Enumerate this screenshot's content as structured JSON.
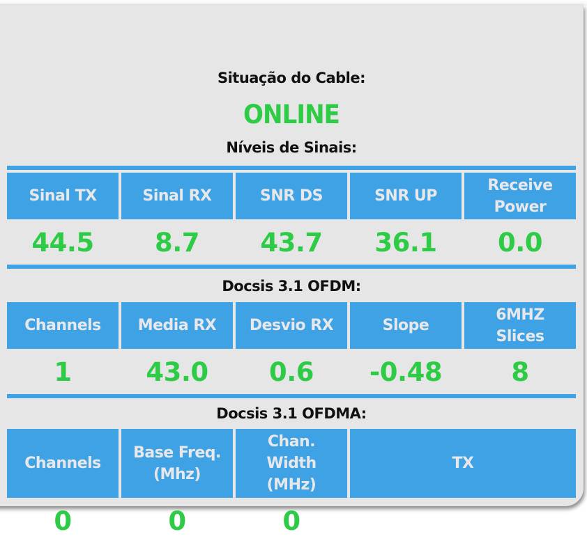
{
  "cable_status": {
    "label": "Situação do Cable:",
    "value": "ONLINE"
  },
  "signal_levels": {
    "title": "Níveis de Sinais:",
    "headers": [
      "Sinal TX",
      "Sinal RX",
      "SNR DS",
      "SNR UP",
      "Receive\nPower"
    ],
    "values": [
      "44.5",
      "8.7",
      "43.7",
      "36.1",
      "0.0"
    ]
  },
  "ofdm": {
    "title": "Docsis 3.1 OFDM:",
    "headers": [
      "Channels",
      "Media RX",
      "Desvio RX",
      "Slope",
      "6MHZ\nSlices"
    ],
    "values": [
      "1",
      "43.0",
      "0.6",
      "-0.48",
      "8"
    ]
  },
  "ofdma": {
    "title": "Docsis 3.1 OFDMA:",
    "headers": [
      "Channels",
      "Base Freq.\n(Mhz)",
      "Chan.\nWidth\n(MHz)",
      "TX"
    ],
    "values": [
      "0",
      "0",
      "0"
    ]
  },
  "colors": {
    "header_bg": "#3fa2e5",
    "value_green": "#2ecc46",
    "panel_bg": "#e6e6e6"
  }
}
